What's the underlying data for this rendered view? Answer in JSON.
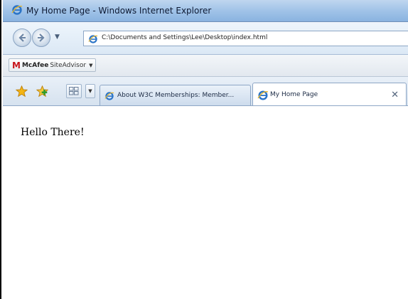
{
  "window": {
    "title": "My Home Page - Windows Internet Explorer"
  },
  "address_bar": {
    "url": "C:\\Documents and Settings\\Lee\\Desktop\\index.html",
    "icon": "ie-page-icon"
  },
  "toolbar": {
    "mcafee_brand": "McAfee",
    "mcafee_product": "SiteAdvisor"
  },
  "tabs": [
    {
      "label": "About W3C Memberships: Member...",
      "active": false,
      "icon": "ie-page-icon"
    },
    {
      "label": "My Home Page",
      "active": true,
      "icon": "ie-page-icon"
    }
  ],
  "page": {
    "body_text": "Hello There!"
  },
  "colors": {
    "titlebar": "#9ec1e7",
    "mcafee_red": "#c8161d",
    "favorites_star": "#f3b515",
    "ie_blue": "#2b74c7"
  }
}
